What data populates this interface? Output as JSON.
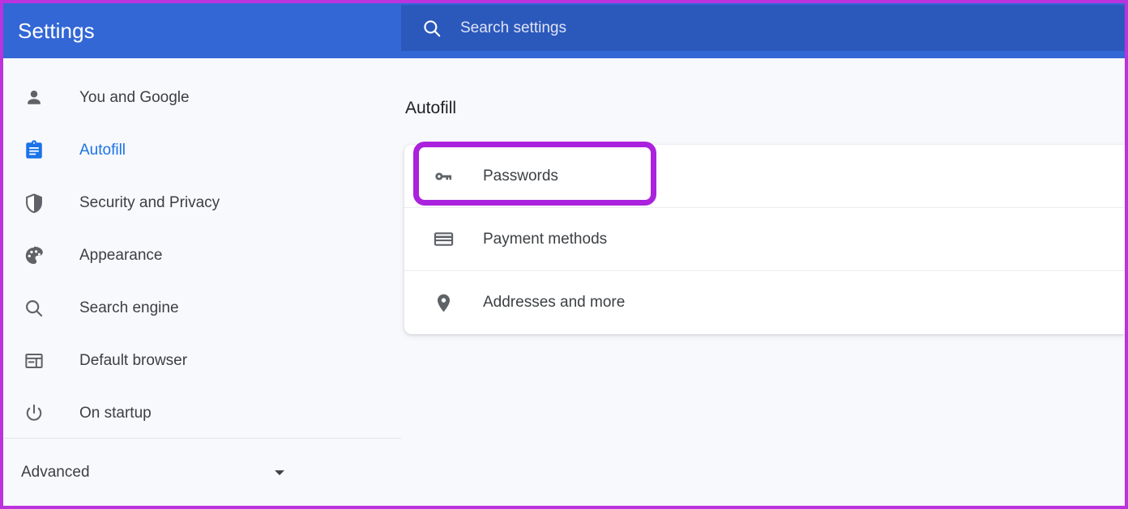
{
  "header": {
    "title": "Settings",
    "search": {
      "icon": "search-icon",
      "placeholder": "Search settings",
      "value": ""
    },
    "background_color": "#3367d6",
    "search_background_color": "#2b58bb"
  },
  "sidebar": {
    "items": [
      {
        "label": "You and Google",
        "icon": "person-icon",
        "active": false
      },
      {
        "label": "Autofill",
        "icon": "clipboard-icon",
        "active": true
      },
      {
        "label": "Security and Privacy",
        "icon": "shield-icon",
        "active": false
      },
      {
        "label": "Appearance",
        "icon": "palette-icon",
        "active": false
      },
      {
        "label": "Search engine",
        "icon": "search-icon",
        "active": false
      },
      {
        "label": "Default browser",
        "icon": "browser-window-icon",
        "active": false
      },
      {
        "label": "On startup",
        "icon": "power-icon",
        "active": false
      }
    ],
    "advanced": {
      "label": "Advanced",
      "icon": "chevron-down-icon"
    },
    "active_color": "#1a73e8",
    "text_color": "#3c4043"
  },
  "main": {
    "section_title": "Autofill",
    "rows": [
      {
        "label": "Passwords",
        "icon": "key-icon",
        "highlighted": true
      },
      {
        "label": "Payment methods",
        "icon": "credit-card-icon",
        "highlighted": false
      },
      {
        "label": "Addresses and more",
        "icon": "location-pin-icon",
        "highlighted": false
      }
    ]
  },
  "annotation": {
    "target": "Passwords",
    "color": "#aa22dd",
    "border_color": "#bb33dd"
  }
}
